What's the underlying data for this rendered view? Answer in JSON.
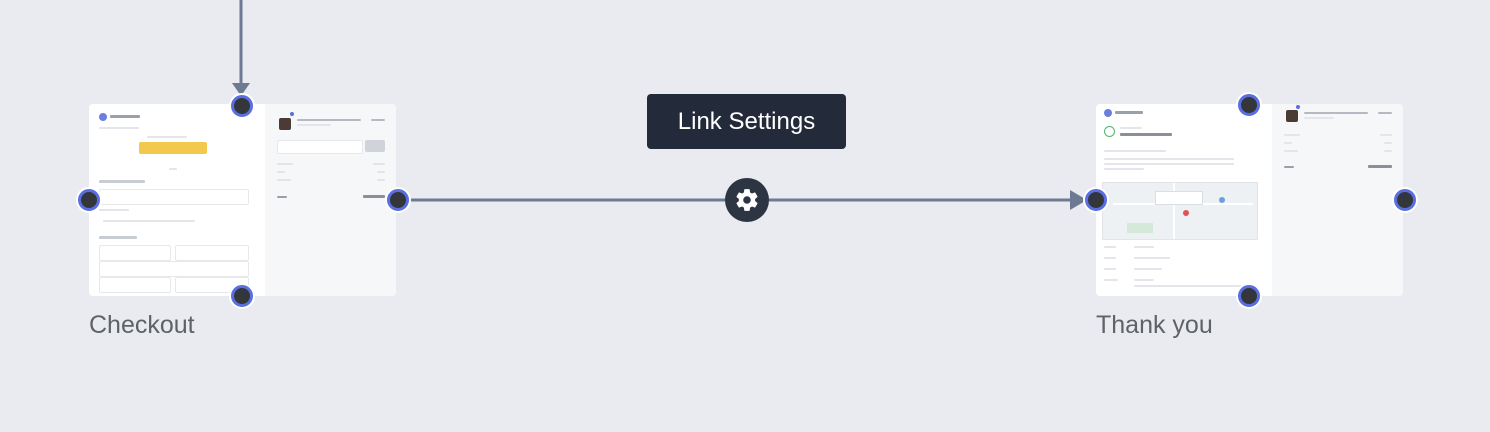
{
  "tooltip": {
    "label": "Link Settings"
  },
  "nodes": {
    "checkout": {
      "label": "Checkout"
    },
    "thank_you": {
      "label": "Thank you"
    }
  },
  "colors": {
    "canvas": "#e9ebf0",
    "wire": "#6d7a92",
    "handle_ring": "#5a6ee0",
    "handle_fill": "#33363b",
    "tooltip_bg": "#232a39"
  },
  "icons": {
    "link_settings": "gear-icon"
  }
}
